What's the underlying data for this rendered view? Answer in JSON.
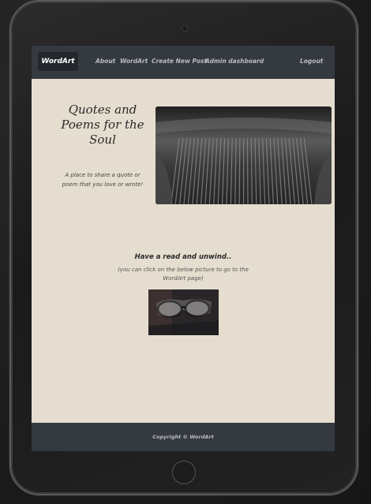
{
  "navbar": {
    "brand": "WordArt",
    "links": [
      "About",
      "WordArt",
      "Create New Post",
      "Admin dashboard"
    ],
    "logout": "Logout"
  },
  "hero": {
    "title": "Quotes and Poems for the Soul",
    "subtitle": "A place to share a quote or poem that you love or wrote!"
  },
  "section": {
    "title": "Have a read and unwind..",
    "note": "(you can click on the below picture to go to the WordArt page)"
  },
  "footer": {
    "copyright": "Copyright © WordArt"
  },
  "colors": {
    "page_bg": "#e5ddcf",
    "navbar_bg": "#343a40",
    "brand_bg": "#23272b",
    "nav_text": "#b8bcc0"
  }
}
